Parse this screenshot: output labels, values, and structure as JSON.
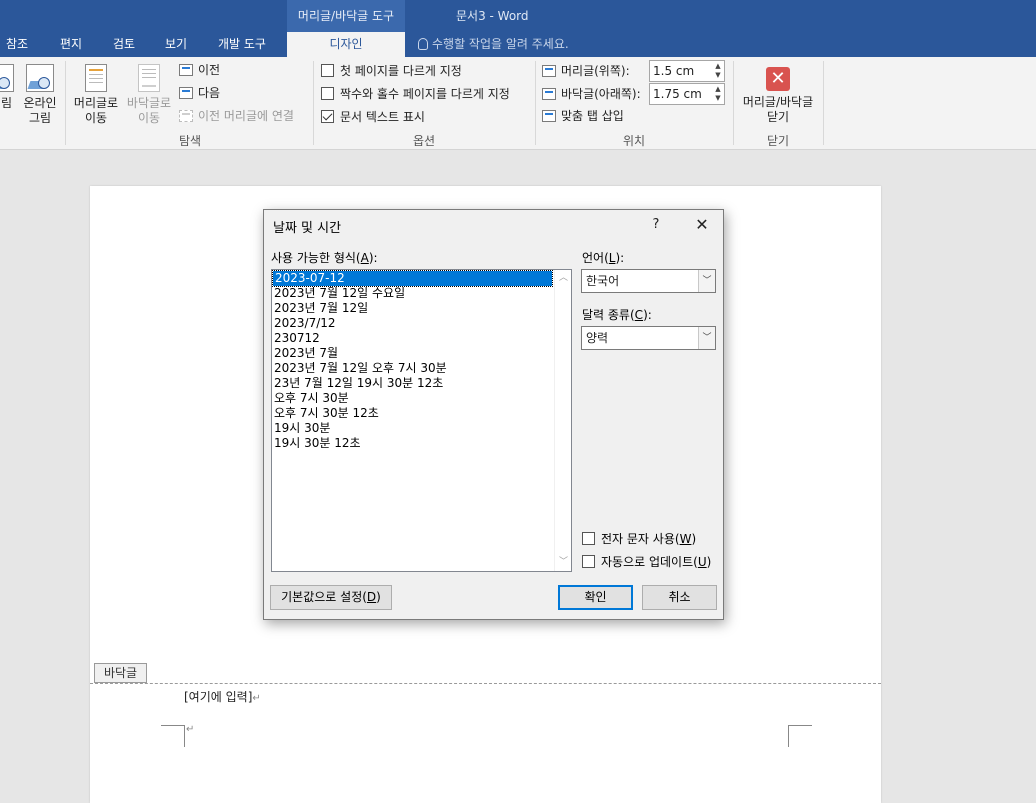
{
  "titlebar": {
    "context_tab_title": "머리글/바닥글 도구",
    "document_title": "문서3 - Word"
  },
  "tabs": {
    "items": [
      "참조",
      "편지",
      "검토",
      "보기",
      "개발 도구"
    ],
    "active": "디자인",
    "tell_me": "수행할 작업을 알려 주세요."
  },
  "ribbon": {
    "insert_group": {
      "picture_partial": "림",
      "online_picture": "온라인 그림"
    },
    "navigation": {
      "label": "탐색",
      "goto_header": "머리글로 이동",
      "goto_footer": "바닥글로 이동",
      "previous": "이전",
      "next": "다음",
      "link_previous": "이전 머리글에 연결"
    },
    "options": {
      "label": "옵션",
      "different_first_page": "첫 페이지를 다르게 지정",
      "different_first_page_checked": false,
      "different_odd_even": "짝수와 홀수 페이지를 다르게 지정",
      "different_odd_even_checked": false,
      "show_document_text": "문서 텍스트 표시",
      "show_document_text_checked": true
    },
    "position": {
      "label": "위치",
      "header_from_top_label": "머리글(위쪽):",
      "header_from_top_value": "1.5 cm",
      "footer_from_bottom_label": "바닥글(아래쪽):",
      "footer_from_bottom_value": "1.75 cm",
      "insert_alignment_tab": "맞춤 탭 삽입"
    },
    "close": {
      "label": "닫기",
      "close_header_footer": "머리글/바닥글 닫기"
    }
  },
  "document": {
    "footer_tag": "바닥글",
    "footer_placeholder": "[여기에 입력]"
  },
  "dialog": {
    "title": "날짜 및 시간",
    "help": "?",
    "formats_label": "사용 가능한 형식(A):",
    "formats_label_text": "사용 가능한 형식(",
    "formats_label_key": "A",
    "formats": [
      "2023-07-12",
      "2023년 7월 12일 수요일",
      "2023년 7월 12일",
      "2023/7/12",
      "230712",
      "2023년 7월",
      "2023년 7월 12일 오후 7시 30분",
      "23년 7월 12일 19시 30분 12초",
      "오후 7시 30분",
      "오후 7시 30분 12초",
      "19시 30분",
      "19시 30분 12초"
    ],
    "selected_format": "2023-07-12",
    "language_label_text": "언어(",
    "language_label_key": "L",
    "language_value": "한국어",
    "calendar_label_text": "달력 종류(",
    "calendar_label_key": "C",
    "calendar_value": "양력",
    "use_fullwidth_text": "전자 문자 사용(",
    "use_fullwidth_key": "W",
    "use_fullwidth_checked": false,
    "auto_update_text": "자동으로 업데이트(",
    "auto_update_key": "U",
    "auto_update_checked": false,
    "set_default_text": "기본값으로 설정(",
    "set_default_key": "D",
    "ok_label": "확인",
    "cancel_label": "취소"
  }
}
